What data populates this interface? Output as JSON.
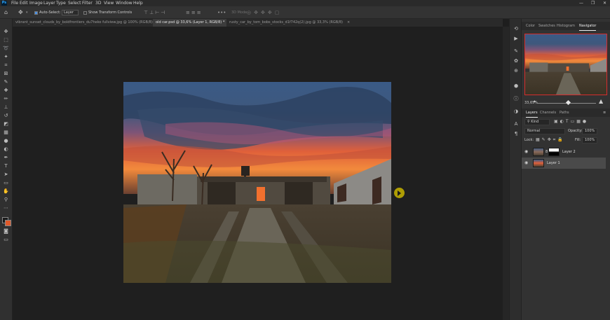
{
  "app": {
    "logo": "Ps"
  },
  "menu": [
    "File",
    "Edit",
    "Image",
    "Layer",
    "Type",
    "Select",
    "Filter",
    "3D",
    "View",
    "Window",
    "Help"
  ],
  "window_controls": {
    "minimize": "—",
    "restore": "❐",
    "close": "✕"
  },
  "options_bar": {
    "auto_select_label": "Auto-Select:",
    "auto_select_value": "Layer",
    "show_transform_label": "Show Transform Controls",
    "mode_3d_label": "3D Mode:"
  },
  "tabs": [
    {
      "label": "vibrant_sunset_clouds_by_boldfrontiers_du7heko fullview.jpg @ 100% (RGB/8)",
      "close": "×"
    },
    {
      "label": "old car.psd @ 33,6% (Layer 1, RGB/8) *",
      "close": "×"
    },
    {
      "label": "rusty_car_by_tom_bobs_stocks_d1f742q(2).jpg @ 33,3% (RGB/8)",
      "close": "×"
    }
  ],
  "panels": {
    "top_tabs": [
      "Color",
      "Swatches",
      "Histogram",
      "Navigator"
    ],
    "active_top_tab": "Navigator",
    "zoom": "33,65%",
    "layer_tabs": [
      "Layers",
      "Channels",
      "Paths"
    ],
    "kind_label": "Kind",
    "blend_mode": "Normal",
    "opacity_label": "Opacity:",
    "opacity_value": "100%",
    "lock_label": "Lock:",
    "fill_label": "Fill:",
    "fill_value": "100%",
    "layers": [
      {
        "name": "Layer 2",
        "selected": false
      },
      {
        "name": "Layer 1",
        "selected": true
      }
    ]
  },
  "colors": {
    "accent": "#31a8ff",
    "selection": "#4a4a4a",
    "nav_frame": "#d62d2d"
  }
}
